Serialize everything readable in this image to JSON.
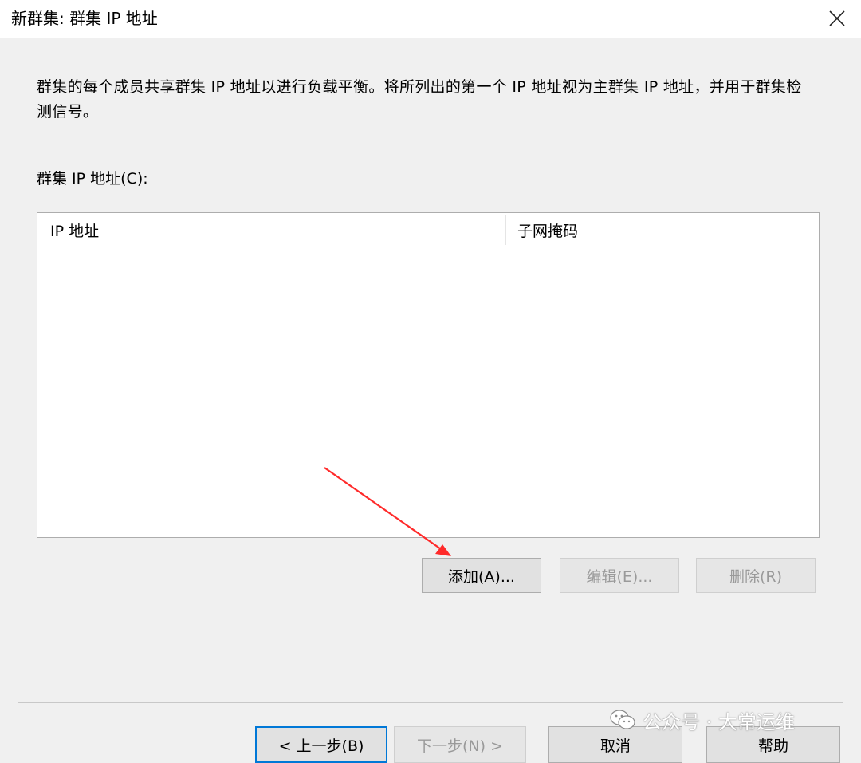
{
  "window": {
    "title": "新群集: 群集 IP 地址",
    "close_icon": "close-icon"
  },
  "description": "群集的每个成员共享群集 IP 地址以进行负载平衡。将所列出的第一个 IP 地址视为主群集 IP 地址，并用于群集检测信号。",
  "ip_list": {
    "label": "群集 IP 地址(C):",
    "columns": [
      "IP 地址",
      "子网掩码"
    ],
    "rows": []
  },
  "list_buttons": {
    "add": "添加(A)...",
    "edit": "编辑(E)...",
    "delete": "删除(R)"
  },
  "footer_buttons": {
    "back": "< 上一步(B)",
    "next": "下一步(N) >",
    "cancel": "取消",
    "help": "帮助"
  },
  "annotation": {
    "arrow_color": "#ff2a2a"
  },
  "watermark": {
    "text": "公众号 · 大常运维",
    "icon": "wechat-icon"
  }
}
